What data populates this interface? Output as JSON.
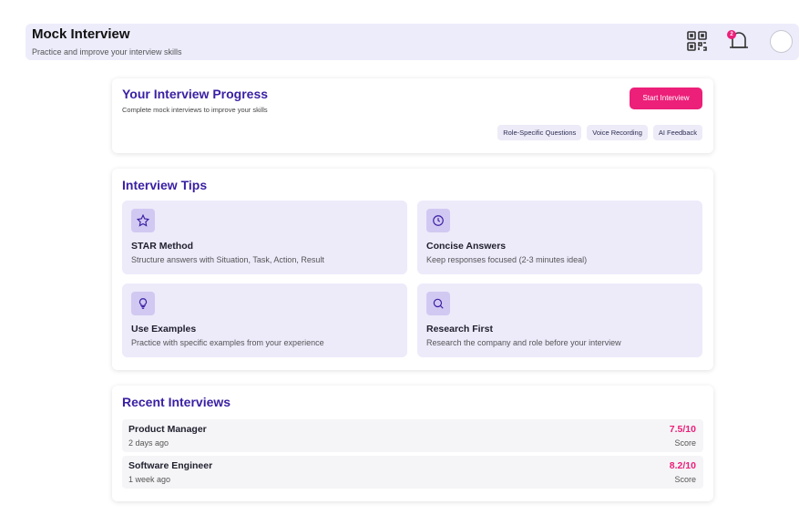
{
  "header": {
    "title": "Mock Interview",
    "subtitle": "Practice and improve your interview skills",
    "notification_count": "2",
    "icons": [
      "qr-code-icon",
      "bell-icon",
      "avatar"
    ]
  },
  "progress": {
    "title": "Your Interview Progress",
    "subtitle": "Complete mock interviews to improve your skills",
    "start_button": "Start Interview",
    "chips": [
      "Role-Specific Questions",
      "Voice Recording",
      "AI Feedback"
    ]
  },
  "tips": {
    "title": "Interview Tips",
    "items": [
      {
        "icon": "star-icon",
        "title": "STAR Method",
        "desc": "Structure answers with Situation, Task, Action, Result"
      },
      {
        "icon": "clock-icon",
        "title": "Concise Answers",
        "desc": "Keep responses focused (2-3 minutes ideal)"
      },
      {
        "icon": "lightbulb-icon",
        "title": "Use Examples",
        "desc": "Practice with specific examples from your experience"
      },
      {
        "icon": "search-icon",
        "title": "Research First",
        "desc": "Research the company and role before your interview"
      }
    ]
  },
  "recent": {
    "title": "Recent Interviews",
    "items": [
      {
        "role": "Product Manager",
        "time": "2 days ago",
        "score": "7.5/10",
        "score_label": "Score"
      },
      {
        "role": "Software Engineer",
        "time": "1 week ago",
        "score": "8.2/10",
        "score_label": "Score"
      }
    ]
  },
  "colors": {
    "accent": "#ec1f79",
    "heading": "#3a1fa3",
    "header_bg": "#ececfb",
    "tip_bg": "#edeafa"
  }
}
